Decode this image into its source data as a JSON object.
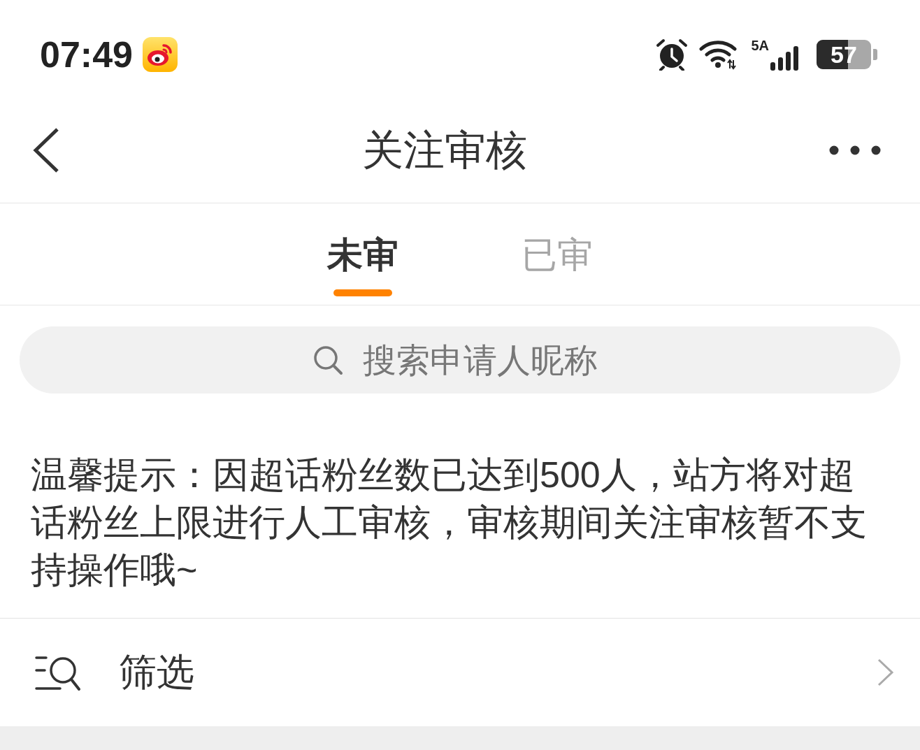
{
  "status_bar": {
    "time": "07:49",
    "network": "5A",
    "battery": "57"
  },
  "nav": {
    "title": "关注审核"
  },
  "tabs": [
    {
      "label": "未审",
      "selected": true
    },
    {
      "label": "已审",
      "selected": false
    }
  ],
  "search": {
    "placeholder": "搜索申请人昵称"
  },
  "notice": "温馨提示：因超话粉丝数已达到500人，站方将对超话粉丝上限进行人工审核，审核期间关注审核暂不支持操作哦~",
  "filter": {
    "label": "筛选"
  }
}
